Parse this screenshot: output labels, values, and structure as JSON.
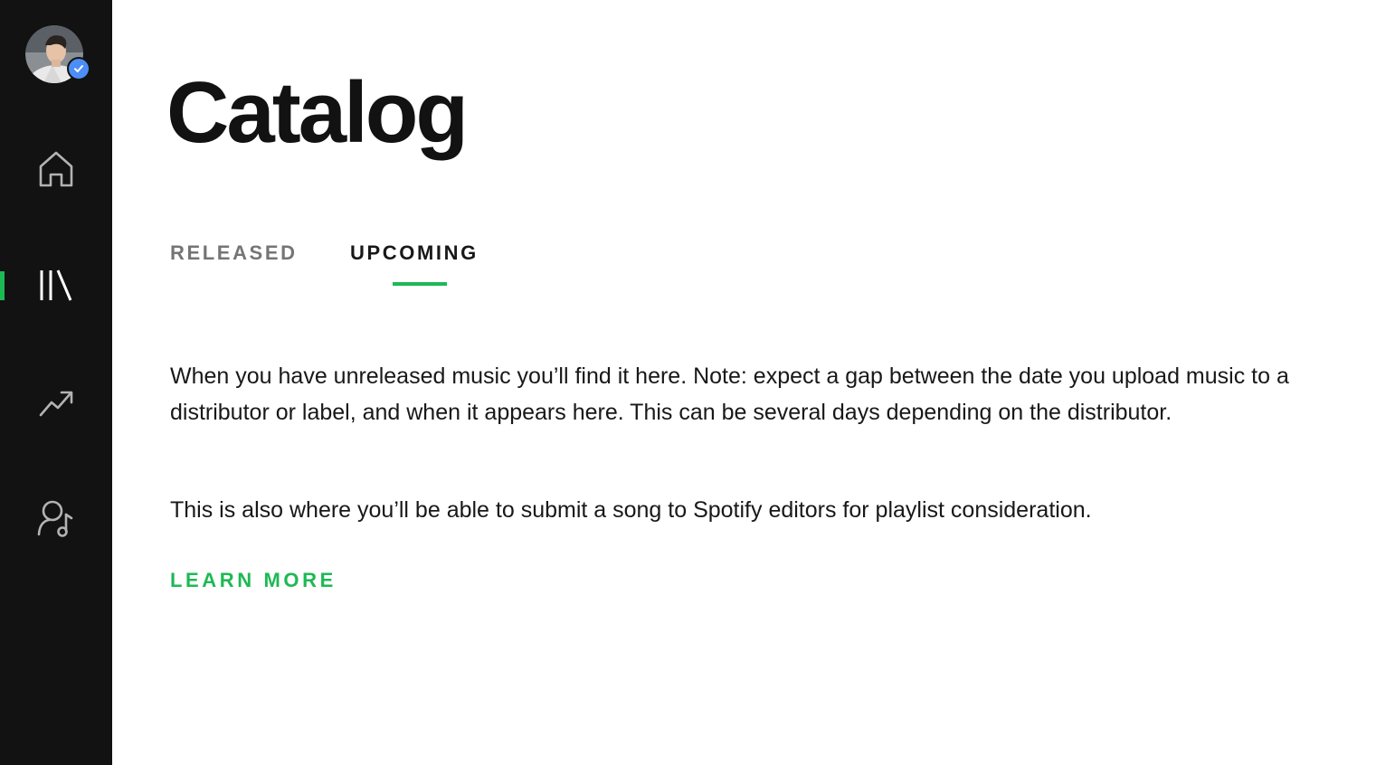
{
  "sidebar": {
    "avatar_alt": "Artist profile",
    "nav": [
      {
        "name": "home",
        "icon": "home-icon"
      },
      {
        "name": "catalog",
        "icon": "library-icon",
        "active": true
      },
      {
        "name": "stats",
        "icon": "trending-up-icon"
      },
      {
        "name": "profile",
        "icon": "artist-profile-icon"
      }
    ],
    "accent_color": "#1db954",
    "background_color": "#121212",
    "badge_color": "#4c8ef5"
  },
  "main": {
    "title": "Catalog",
    "tabs": [
      {
        "label": "RELEASED",
        "active": false
      },
      {
        "label": "UPCOMING",
        "active": true
      }
    ],
    "description": "When you have unreleased music you’ll find it here. Note: expect a gap between the date you upload music to a distributor or label, and when it appears here. This can be several days depending on the distributor.",
    "description_2": "This is also where you’ll be able to submit a song to Spotify editors for playlist consideration.",
    "learn_more": "LEARN MORE"
  }
}
